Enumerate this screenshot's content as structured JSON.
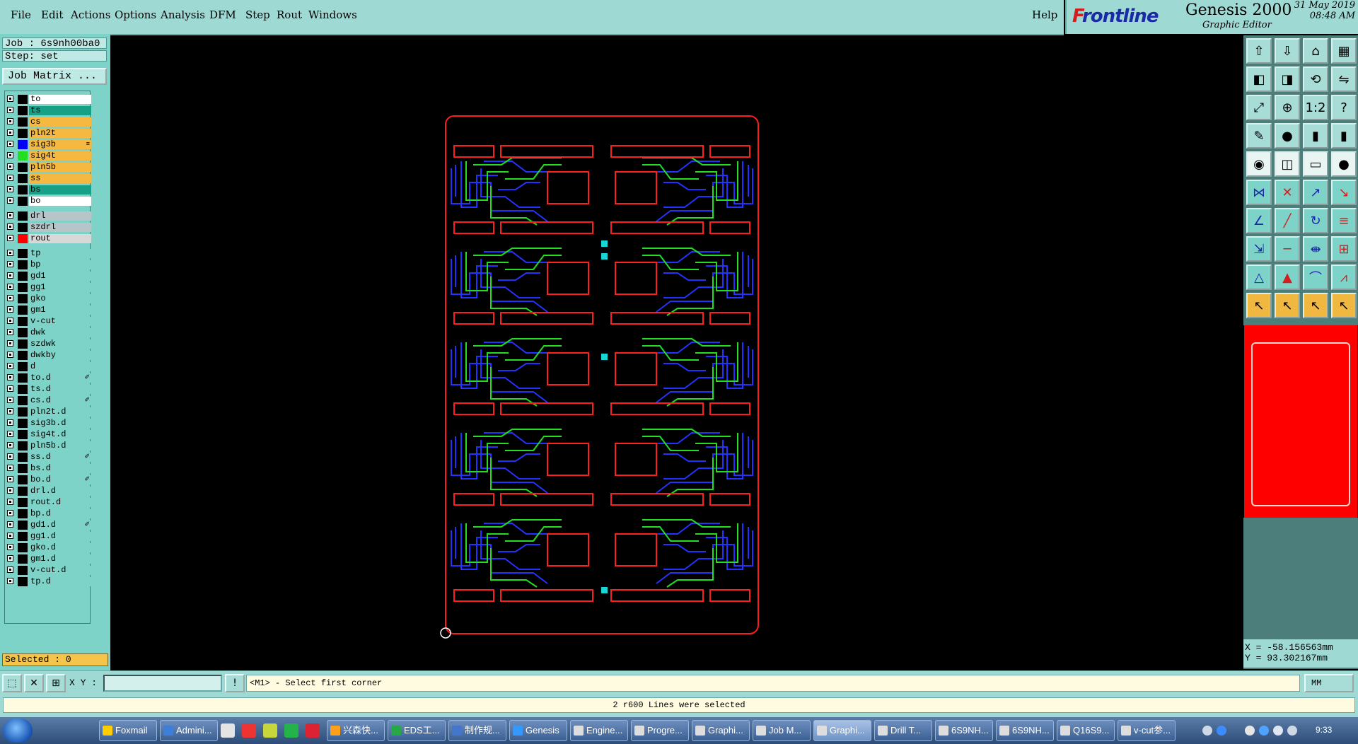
{
  "menubar": {
    "items": [
      "File",
      "Edit",
      "Actions",
      "Options",
      "Analysis",
      "DFM",
      "Step",
      "Rout",
      "Windows"
    ],
    "help": "Help"
  },
  "branding": {
    "logo_f": "F",
    "logo_rest": "rontline",
    "product": "Genesis 2000",
    "subtitle": "Graphic Editor",
    "date": "31 May 2019",
    "time": "08:48 AM"
  },
  "job": {
    "label": "Job : 6s9nh00ba0",
    "step": "Step: set"
  },
  "job_matrix_button": "Job Matrix ...",
  "layers": [
    {
      "name": "to",
      "color": "#ffffff",
      "swatch": "#000000"
    },
    {
      "name": "ts",
      "color": "#16a085",
      "swatch": "#000000"
    },
    {
      "name": "cs",
      "color": "#f5b840",
      "swatch": "#000000"
    },
    {
      "name": "pln2t",
      "color": "#f5b840",
      "swatch": "#000000"
    },
    {
      "name": "sig3b",
      "color": "#f5b840",
      "swatch": "#0000ff",
      "active": true,
      "mark": "≡"
    },
    {
      "name": "sig4t",
      "color": "#f5b840",
      "swatch": "#22dd22"
    },
    {
      "name": "pln5b",
      "color": "#f5b840",
      "swatch": "#000000"
    },
    {
      "name": "ss",
      "color": "#f5b840",
      "swatch": "#000000"
    },
    {
      "name": "bs",
      "color": "#16a085",
      "swatch": "#000000"
    },
    {
      "name": "bo",
      "color": "#ffffff",
      "swatch": "#000000"
    },
    {
      "name": "drl",
      "color": "#b7c5c9",
      "swatch": "#000000",
      "gap": true
    },
    {
      "name": "szdrl",
      "color": "#b7c5c9",
      "swatch": "#000000"
    },
    {
      "name": "rout",
      "color": "#d8d8d8",
      "swatch": "#ff0000"
    },
    {
      "name": "tp",
      "color": "#7dd3c8",
      "swatch": "#000000",
      "gap": true
    },
    {
      "name": "bp",
      "color": "#7dd3c8",
      "swatch": "#000000"
    },
    {
      "name": "gd1",
      "color": "#7dd3c8",
      "swatch": "#000000"
    },
    {
      "name": "gg1",
      "color": "#7dd3c8",
      "swatch": "#000000"
    },
    {
      "name": "gko",
      "color": "#7dd3c8",
      "swatch": "#000000"
    },
    {
      "name": "gm1",
      "color": "#7dd3c8",
      "swatch": "#000000"
    },
    {
      "name": "v-cut",
      "color": "#7dd3c8",
      "swatch": "#000000"
    },
    {
      "name": "dwk",
      "color": "#7dd3c8",
      "swatch": "#000000"
    },
    {
      "name": "szdwk",
      "color": "#7dd3c8",
      "swatch": "#000000"
    },
    {
      "name": "dwkby",
      "color": "#7dd3c8",
      "swatch": "#000000"
    },
    {
      "name": "d",
      "color": "#7dd3c8",
      "swatch": "#000000"
    },
    {
      "name": "to.d",
      "color": "#7dd3c8",
      "swatch": "#000000",
      "mark": "✐"
    },
    {
      "name": "ts.d",
      "color": "#7dd3c8",
      "swatch": "#000000"
    },
    {
      "name": "cs.d",
      "color": "#7dd3c8",
      "swatch": "#000000",
      "mark": "✐"
    },
    {
      "name": "pln2t.d",
      "color": "#7dd3c8",
      "swatch": "#000000"
    },
    {
      "name": "sig3b.d",
      "color": "#7dd3c8",
      "swatch": "#000000"
    },
    {
      "name": "sig4t.d",
      "color": "#7dd3c8",
      "swatch": "#000000"
    },
    {
      "name": "pln5b.d",
      "color": "#7dd3c8",
      "swatch": "#000000"
    },
    {
      "name": "ss.d",
      "color": "#7dd3c8",
      "swatch": "#000000",
      "mark": "✐"
    },
    {
      "name": "bs.d",
      "color": "#7dd3c8",
      "swatch": "#000000"
    },
    {
      "name": "bo.d",
      "color": "#7dd3c8",
      "swatch": "#000000",
      "mark": "✐"
    },
    {
      "name": "drl.d",
      "color": "#7dd3c8",
      "swatch": "#000000"
    },
    {
      "name": "rout.d",
      "color": "#7dd3c8",
      "swatch": "#000000"
    },
    {
      "name": "bp.d",
      "color": "#7dd3c8",
      "swatch": "#000000"
    },
    {
      "name": "gd1.d",
      "color": "#7dd3c8",
      "swatch": "#000000",
      "mark": "✐"
    },
    {
      "name": "gg1.d",
      "color": "#7dd3c8",
      "swatch": "#000000"
    },
    {
      "name": "gko.d",
      "color": "#7dd3c8",
      "swatch": "#000000"
    },
    {
      "name": "gm1.d",
      "color": "#7dd3c8",
      "swatch": "#000000"
    },
    {
      "name": "v-cut.d",
      "color": "#7dd3c8",
      "swatch": "#000000"
    },
    {
      "name": "tp.d",
      "color": "#7dd3c8",
      "swatch": "#000000"
    }
  ],
  "selected": "Selected : 0",
  "coords": {
    "x": "X = -58.156563mm",
    "y": "Y = 93.302167mm"
  },
  "command": {
    "xy_label": "X Y :",
    "prompt": "<M1> - Select first corner",
    "units": "MM"
  },
  "status": "2 r600 Lines were selected",
  "toolbar_icons": [
    "export-icon",
    "import-icon",
    "home-icon",
    "panel-icon",
    "left-icon",
    "right-icon",
    "rotate-icon",
    "mirror-icon",
    "fit-icon",
    "zoom-icon",
    "scale-icon",
    "help-icon",
    "measure-icon",
    "snap-icon",
    "layers-icon",
    "layers2-icon",
    "pad-icon",
    "add-shape-icon",
    "line-icon",
    "circle-icon",
    "connect-icon",
    "delete-icon",
    "move-icon",
    "copy-icon",
    "edit-icon",
    "draw-icon",
    "arc-icon",
    "text-icon",
    "resize-icon",
    "cut-icon",
    "stretch-icon",
    "array-icon",
    "vertex-icon",
    "triangle-icon",
    "arc2-icon",
    "contour-icon",
    "select-icon",
    "select2-icon",
    "select3-icon",
    "select4-icon"
  ],
  "taskbar": {
    "items": [
      "Foxmail",
      "Admini...",
      "",
      "",
      "",
      "",
      "",
      "兴森快...",
      "EDS工...",
      "制作规...",
      "Genesis",
      "Engine...",
      "Progre...",
      "Graphi...",
      "Job M...",
      "Graphi...",
      "Drill T...",
      "6S9NH...",
      "6S9NH...",
      "Q16S9...",
      "v-cut参..."
    ],
    "clock": "9:33"
  }
}
